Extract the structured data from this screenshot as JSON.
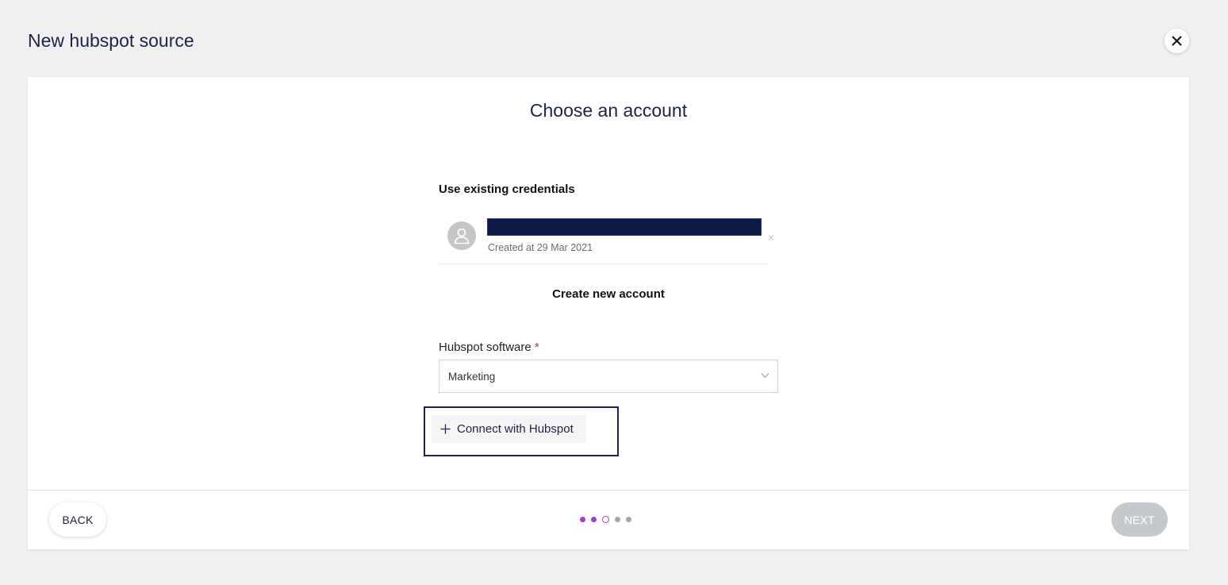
{
  "header": {
    "title": "New hubspot source",
    "close_icon": "close-icon"
  },
  "card": {
    "title": "Choose an account",
    "existing": {
      "label": "Use existing credentials",
      "credentials": [
        {
          "name": "",
          "created": "Created at 29 Mar 2021",
          "remove": "×"
        }
      ]
    },
    "create": {
      "label": "Create new account",
      "software_field": {
        "label": "Hubspot software",
        "required_mark": "*",
        "value": "Marketing"
      },
      "connect_label": "Connect with Hubspot"
    }
  },
  "footer": {
    "back_label": "BACK",
    "next_label": "NEXT",
    "steps": [
      "done",
      "done",
      "current",
      "todo",
      "todo"
    ]
  },
  "colors": {
    "accent": "#9b3fd6",
    "title_text": "#1e2347",
    "redaction": "#0b1a47",
    "next_disabled": "#c5c8cd"
  }
}
